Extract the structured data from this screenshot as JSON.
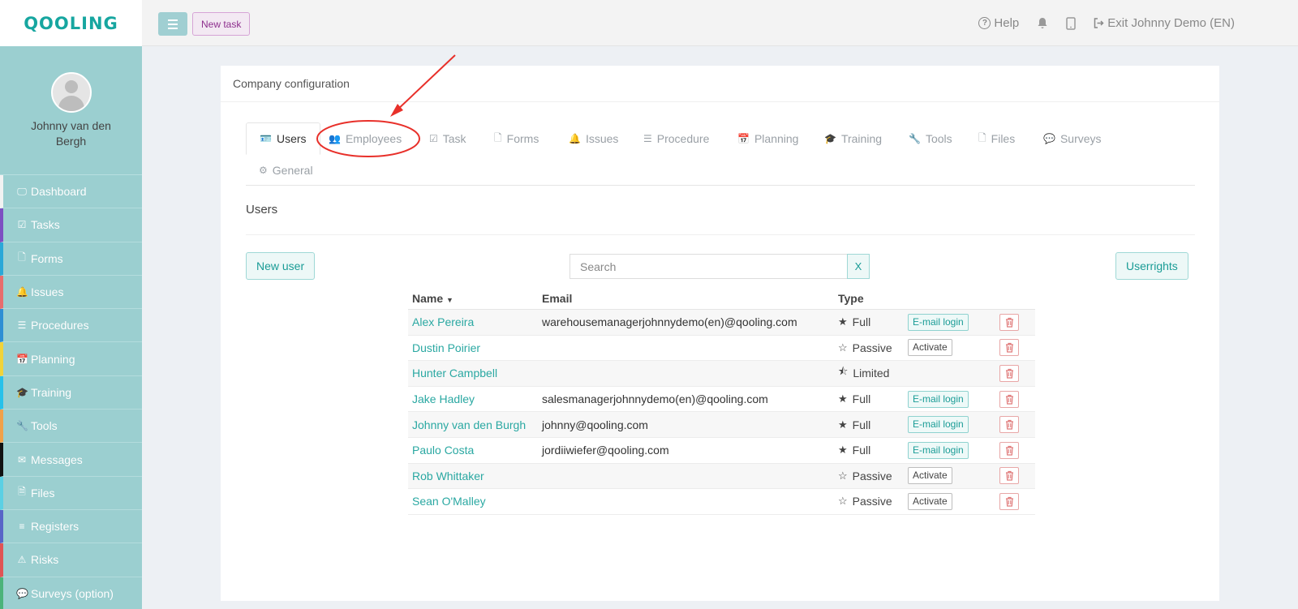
{
  "brand": {
    "logo": "QOOLING"
  },
  "profile": {
    "name": "Johnny van den Bergh"
  },
  "sidebar": {
    "items": [
      {
        "label": "Dashboard",
        "icon": "monitor-icon",
        "color": "#f2f2f2"
      },
      {
        "label": "Tasks",
        "icon": "check-square-icon",
        "color": "#7d4fc2"
      },
      {
        "label": "Forms",
        "icon": "file-icon",
        "color": "#2aa8d8"
      },
      {
        "label": "Issues",
        "icon": "bell-icon",
        "color": "#e86d6d"
      },
      {
        "label": "Procedures",
        "icon": "list-icon",
        "color": "#2f8fd4"
      },
      {
        "label": "Planning",
        "icon": "calendar-icon",
        "color": "#f0d33a"
      },
      {
        "label": "Training",
        "icon": "graduation-cap-icon",
        "color": "#27c1ea"
      },
      {
        "label": "Tools",
        "icon": "wrench-icon",
        "color": "#f0a14a"
      },
      {
        "label": "Messages",
        "icon": "envelope-icon",
        "color": "#111111"
      },
      {
        "label": "Files",
        "icon": "pdf-file-icon",
        "color": "#5bd0e4"
      },
      {
        "label": "Registers",
        "icon": "bars-icon",
        "color": "#5865c7"
      },
      {
        "label": "Risks",
        "icon": "warning-icon",
        "color": "#e05454"
      },
      {
        "label": "Surveys (option)",
        "icon": "chat-icon",
        "color": "#4bb37a"
      }
    ]
  },
  "topbar": {
    "new_task": "New task",
    "help": "Help",
    "exit": "Exit Johnny Demo (EN)"
  },
  "card": {
    "title": "Company configuration"
  },
  "tabs": [
    {
      "label": "Users",
      "icon": "id-card-icon",
      "glyph": "🪪",
      "active": true
    },
    {
      "label": "Employees",
      "icon": "users-icon",
      "glyph": "👥",
      "active": false
    },
    {
      "label": "Task",
      "icon": "check-icon",
      "glyph": "☑",
      "active": false
    },
    {
      "label": "Forms",
      "icon": "file-icon",
      "glyph": "🗋",
      "active": false
    },
    {
      "label": "Issues",
      "icon": "bell-icon",
      "glyph": "🔔",
      "active": false
    },
    {
      "label": "Procedure",
      "icon": "list-icon",
      "glyph": "☰",
      "active": false
    },
    {
      "label": "Planning",
      "icon": "calendar-icon",
      "glyph": "📅",
      "active": false
    },
    {
      "label": "Training",
      "icon": "graduation-cap-icon",
      "glyph": "🎓",
      "active": false
    },
    {
      "label": "Tools",
      "icon": "wrench-icon",
      "glyph": "🔧",
      "active": false
    },
    {
      "label": "Files",
      "icon": "file-icon",
      "glyph": "🗋",
      "active": false
    },
    {
      "label": "Surveys",
      "icon": "chat-icon",
      "glyph": "💬",
      "active": false
    },
    {
      "label": "General",
      "icon": "gear-icon",
      "glyph": "⚙",
      "active": false
    }
  ],
  "users_section": {
    "title": "Users",
    "new_user": "New user",
    "search_placeholder": "Search",
    "search_clear": "X",
    "userrights": "Userrights"
  },
  "table": {
    "headers": {
      "name": "Name",
      "email": "Email",
      "type": "Type"
    },
    "rows": [
      {
        "name": "Alex Pereira",
        "email": "warehousemanagerjohnnydemo(en)@qooling.com",
        "type": "Full",
        "star": "full",
        "action": "E-mail login"
      },
      {
        "name": "Dustin Poirier",
        "email": "",
        "type": "Passive",
        "star": "empty",
        "action": "Activate"
      },
      {
        "name": "Hunter Campbell",
        "email": "",
        "type": "Limited",
        "star": "half",
        "action": ""
      },
      {
        "name": "Jake Hadley",
        "email": "salesmanagerjohnnydemo(en)@qooling.com",
        "type": "Full",
        "star": "full",
        "action": "E-mail login"
      },
      {
        "name": "Johnny van den Burgh",
        "email": "johnny@qooling.com",
        "type": "Full",
        "star": "full",
        "action": "E-mail login"
      },
      {
        "name": "Paulo Costa",
        "email": "jordiiwiefer@qooling.com",
        "type": "Full",
        "star": "full",
        "action": "E-mail login"
      },
      {
        "name": "Rob Whittaker",
        "email": "",
        "type": "Passive",
        "star": "empty",
        "action": "Activate"
      },
      {
        "name": "Sean O'Malley",
        "email": "",
        "type": "Passive",
        "star": "empty",
        "action": "Activate"
      }
    ]
  },
  "colors": {
    "accent": "#2aa8a2",
    "annotation": "#e8302a",
    "sidebar_bg": "#9bcfd0"
  }
}
